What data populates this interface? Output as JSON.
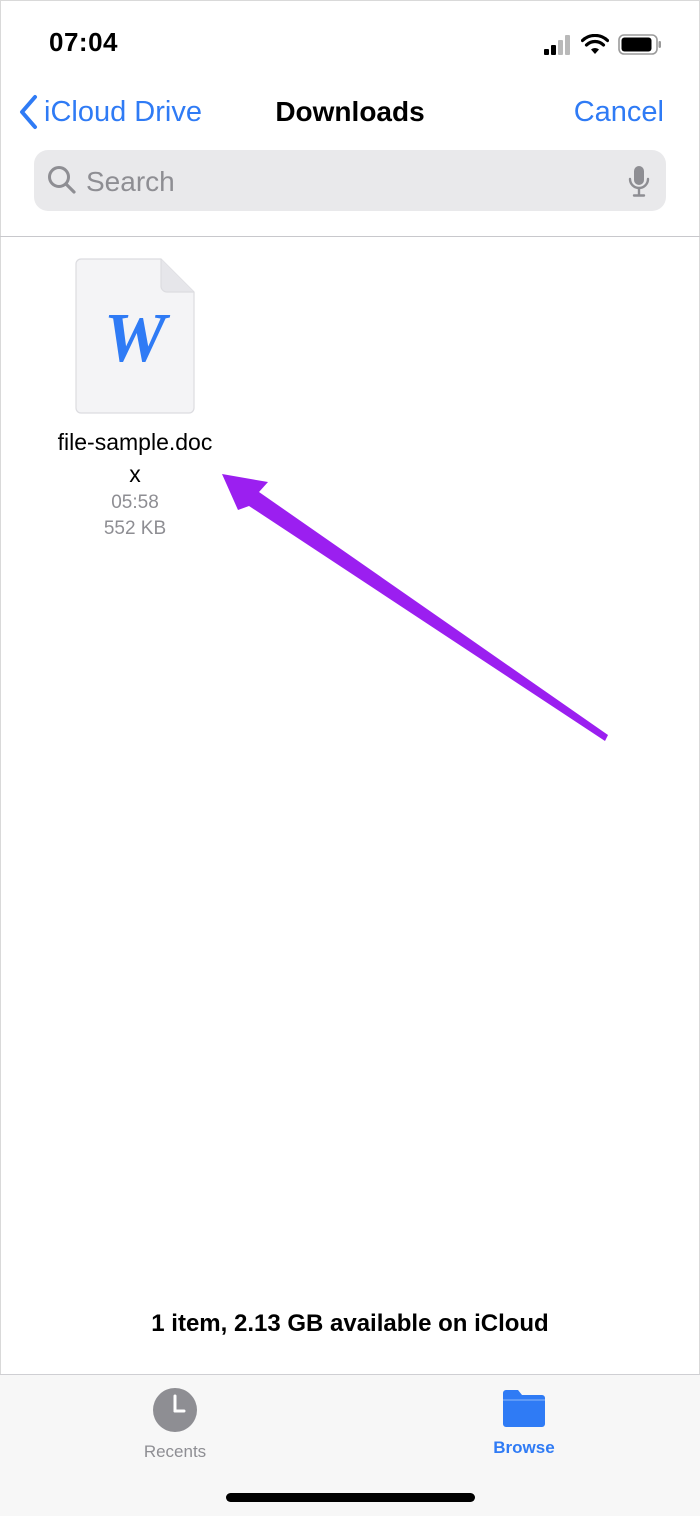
{
  "status_bar": {
    "time": "07:04",
    "icons": [
      "cellular-signal-icon",
      "wifi-icon",
      "battery-icon"
    ]
  },
  "nav": {
    "back_label": "iCloud Drive",
    "title": "Downloads",
    "cancel_label": "Cancel"
  },
  "search": {
    "placeholder": "Search",
    "value": ""
  },
  "files": [
    {
      "name": "file-sample.docx",
      "time": "05:58",
      "size": "552 KB",
      "icon_letter": "W",
      "icon": "word-document-icon"
    }
  ],
  "footer": {
    "storage_text": "1 item, 2.13 GB available on iCloud"
  },
  "tabs": [
    {
      "label": "Recents",
      "icon": "clock-icon",
      "active": false
    },
    {
      "label": "Browse",
      "icon": "folder-icon",
      "active": true
    }
  ],
  "colors": {
    "accent": "#2f7bf5",
    "annotation_arrow": "#9b1ff0",
    "secondary_text": "#8e8e93"
  }
}
